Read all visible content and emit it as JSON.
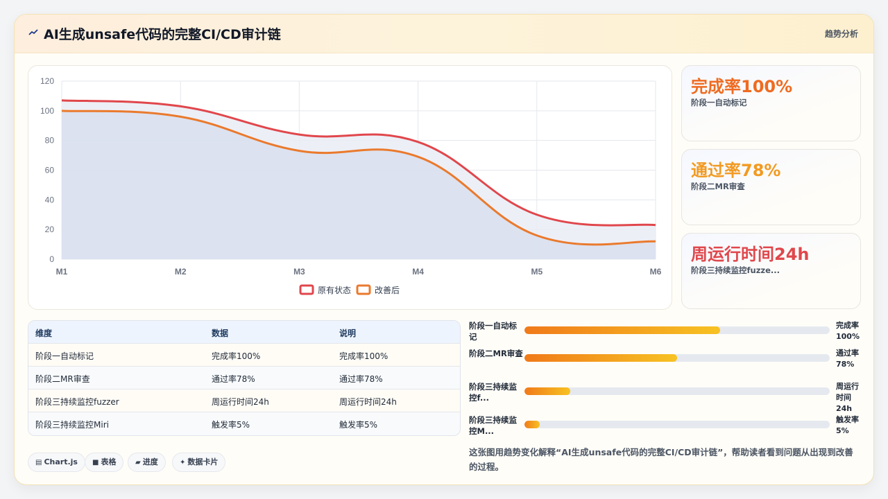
{
  "header": {
    "title": "AI生成unsafe代码的完整CI/CD审计链",
    "tag": "趋势分析"
  },
  "chart_data": {
    "type": "area",
    "categories": [
      "M1",
      "M2",
      "M3",
      "M4",
      "M5",
      "M6"
    ],
    "series": [
      {
        "name": "原有状态",
        "values": [
          107,
          103,
          84,
          79,
          30,
          23
        ],
        "color": "#e0474c"
      },
      {
        "name": "改善后",
        "values": [
          100,
          96,
          73,
          69,
          16,
          12
        ],
        "color": "#ea7a2d"
      }
    ],
    "yticks": [
      "0",
      "20",
      "40",
      "60",
      "80",
      "100",
      "120"
    ],
    "ylim": [
      0,
      120
    ],
    "grid": true,
    "legend": "bottom"
  },
  "stats": [
    {
      "value": "完成率100%",
      "label": "阶段一自动标记",
      "color": "#ef6b21"
    },
    {
      "value": "通过率78%",
      "label": "阶段二MR审查",
      "color": "#f29a22"
    },
    {
      "value": "周运行时间24h",
      "label": "阶段三持续监控fuzze...",
      "color": "#e0474c"
    }
  ],
  "table": {
    "headers": [
      "维度",
      "数据",
      "说明"
    ],
    "rows": [
      [
        "阶段一自动标记",
        "完成率100%",
        "完成率100%"
      ],
      [
        "阶段二MR审查",
        "通过率78%",
        "通过率78%"
      ],
      [
        "阶段三持续监控fuzzer",
        "周运行时间24h",
        "周运行时间24h"
      ],
      [
        "阶段三持续监控Miri",
        "触发率5%",
        "触发率5%"
      ]
    ]
  },
  "progress": [
    {
      "label": "阶段一自动标记",
      "value": "完成率100%",
      "fill": 0.64
    },
    {
      "label": "阶段二MR审查",
      "value": "通过率78%",
      "fill": 0.5
    },
    {
      "label": "阶段三持续监控f...",
      "value": "周运行时间24h",
      "fill": 0.15
    },
    {
      "label": "阶段三持续监控M...",
      "value": "触发率5%",
      "fill": 0.05
    }
  ],
  "chips": [
    {
      "icon": "chart-icon",
      "label": "Chart.js"
    },
    {
      "icon": "table-icon",
      "label": "表格"
    },
    {
      "icon": "progress-icon",
      "label": "进度"
    },
    {
      "icon": "card-icon",
      "label": "数据卡片"
    }
  ],
  "caption": "这张图用趋势变化解释“AI生成unsafe代码的完整CI/CD审计链”，帮助读者看到问题从出现到改善的过程。"
}
